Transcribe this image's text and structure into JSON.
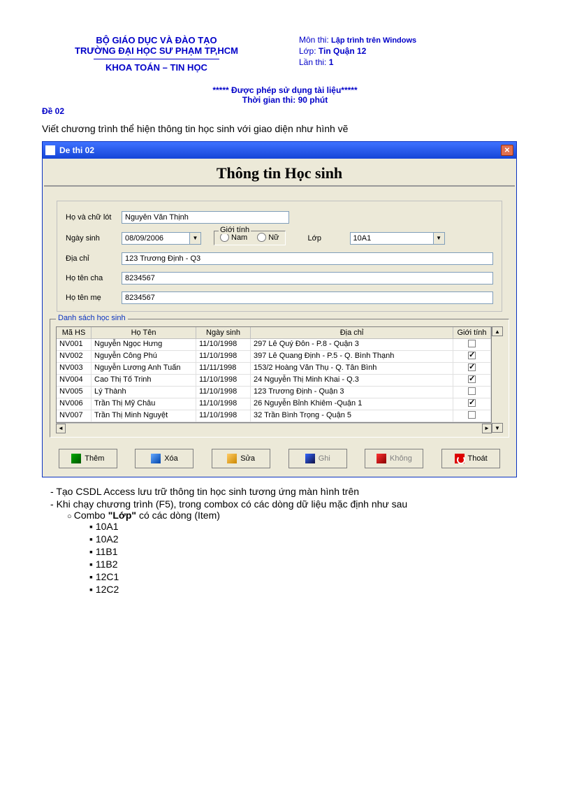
{
  "header": {
    "left1": "BỘ GIÁO DỤC VÀ ĐÀO TẠO",
    "left2": "TRƯỜNG ĐẠI HỌC SƯ PHẠM TP,HCM",
    "left3": "KHOA TOÁN – TIN HỌC",
    "right_mon_label": "Môn thi: ",
    "right_mon_val": "Lập trình trên Windows",
    "right_lop_label": "Lớp: ",
    "right_lop_val": "Tin Quận 12",
    "right_lan_label": "Lần thi: ",
    "right_lan_val": "1"
  },
  "notice": {
    "line1": "***** Được phép sử dụng tài liệu*****",
    "line2": "Thời gian thi: 90 phút"
  },
  "de": "Đề 02",
  "task_intro": "Viết chương trình thể hiện thông tin học sinh với giao diện như hình vẽ",
  "app": {
    "title": "De thi 02",
    "heading": "Thông tin Học sinh",
    "labels": {
      "ho": "Họ và chữ lót",
      "ngay": "Ngày sinh",
      "gt": "Giới tính",
      "nam": "Nam",
      "nu": "Nữ",
      "lop": "Lớp",
      "dc": "Địa chỉ",
      "cha": "Họ tên cha",
      "me": "Họ tên mẹ",
      "ds": "Danh sách học sinh"
    },
    "values": {
      "ho": "Nguyễn Văn Thịnh",
      "ngay": "08/09/2006",
      "lop": "10A1",
      "dc": "123 Trương Định - Q3",
      "cha": "8234567",
      "me": "8234567"
    },
    "grid": {
      "cols": {
        "ma": "Mã HS",
        "ten": "Họ Tên",
        "ngay": "Ngày sinh",
        "dc": "Địa chỉ",
        "gt": "Giới tính"
      },
      "rows": [
        {
          "ma": "NV001",
          "ten": "Nguyễn Ngọc Hưng",
          "ngay": "11/10/1998",
          "dc": "297 Lê Quý Đôn - P.8 - Quận 3",
          "gt": false
        },
        {
          "ma": "NV002",
          "ten": "Nguyễn Công Phú",
          "ngay": "11/10/1998",
          "dc": "397 Lê Quang Định - P.5 - Q. Bình Thạnh",
          "gt": true
        },
        {
          "ma": "NV003",
          "ten": "Nguyễn Lương Anh Tuấn",
          "ngay": "11/11/1998",
          "dc": "153/2 Hoàng Văn Thụ - Q. Tân Bình",
          "gt": true
        },
        {
          "ma": "NV004",
          "ten": "Cao Thị Tố Trinh",
          "ngay": "11/10/1998",
          "dc": "24 Nguyễn Thị Minh Khai - Q.3",
          "gt": true
        },
        {
          "ma": "NV005",
          "ten": "Lý Thành",
          "ngay": "11/10/1998",
          "dc": "123 Trương Định - Quận 3",
          "gt": false
        },
        {
          "ma": "NV006",
          "ten": "Trần Thị Mỹ Châu",
          "ngay": "11/10/1998",
          "dc": "26 Nguyễn Bỉnh Khiêm -Quận 1",
          "gt": true
        },
        {
          "ma": "NV007",
          "ten": "Trần Thị Minh Nguyệt",
          "ngay": "11/10/1998",
          "dc": "32 Trần Bình Trọng - Quận 5",
          "gt": false
        }
      ]
    },
    "buttons": {
      "them": "Thêm",
      "xoa": "Xóa",
      "sua": "Sửa",
      "ghi": "Ghi",
      "khong": "Không",
      "thoat": "Thoát"
    }
  },
  "tasks": {
    "t1": "Tạo CSDL Access lưu trữ thông tin học sinh tương ứng màn hình trên",
    "t2": "Khi chạy chương trình (F5), trong combox có các dòng dữ liệu mặc định như sau",
    "t2a_pre": "Combo ",
    "t2a_bold": "\"Lớp\"",
    "t2a_post": " có các dòng (Item)",
    "items": [
      "10A1",
      "10A2",
      "11B1",
      "11B2",
      "12C1",
      "12C2"
    ]
  }
}
